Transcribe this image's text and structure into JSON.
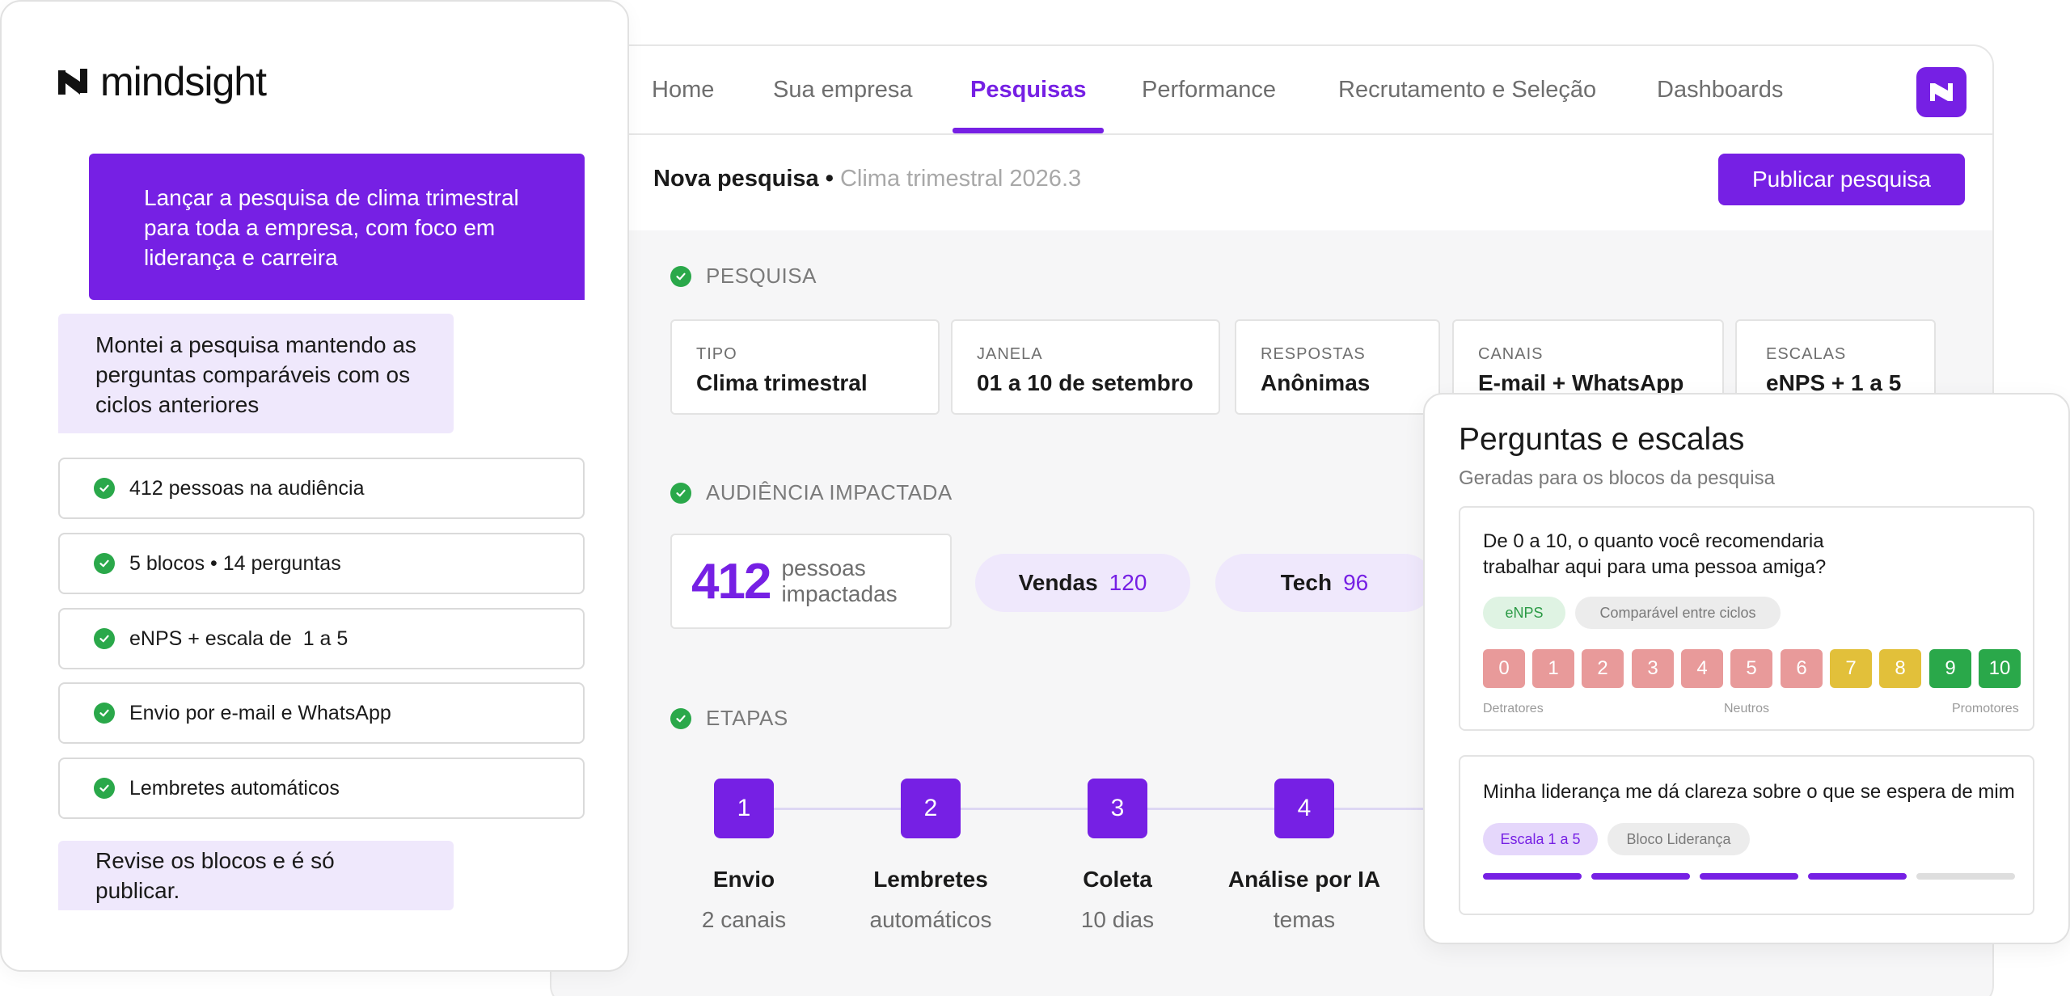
{
  "brand": {
    "name": "mindsight"
  },
  "nav": {
    "tabs": [
      {
        "label": "Home",
        "active": false
      },
      {
        "label": "Sua empresa",
        "active": false
      },
      {
        "label": "Pesquisas",
        "active": true
      },
      {
        "label": "Performance",
        "active": false
      },
      {
        "label": "Recrutamento e Seleção",
        "active": false
      },
      {
        "label": "Dashboards",
        "active": false
      }
    ]
  },
  "subheader": {
    "title": "Nova pesquisa",
    "separator": "•",
    "subtitle": "Clima trimestral 2026.3",
    "publish_button": "Publicar pesquisa"
  },
  "pesquisa": {
    "heading": "PESQUISA",
    "cards": [
      {
        "label": "TIPO",
        "value": "Clima trimestral"
      },
      {
        "label": "JANELA",
        "value": "01 a 10 de setembro"
      },
      {
        "label": "RESPOSTAS",
        "value": "Anônimas"
      },
      {
        "label": "CANAIS",
        "value": "E-mail + WhatsApp"
      },
      {
        "label": "ESCALAS",
        "value": "eNPS + 1 a 5"
      }
    ]
  },
  "audiencia": {
    "heading": "AUDIÊNCIA IMPACTADA",
    "total": "412",
    "total_label": "pessoas impactadas",
    "groups": [
      {
        "name": "Vendas",
        "count": "120"
      },
      {
        "name": "Tech",
        "count": "96"
      }
    ]
  },
  "etapas": {
    "heading": "ETAPAS",
    "steps": [
      {
        "num": "1",
        "name": "Envio",
        "detail": "2 canais"
      },
      {
        "num": "2",
        "name": "Lembretes",
        "detail": "automáticos"
      },
      {
        "num": "3",
        "name": "Coleta",
        "detail": "10 dias"
      },
      {
        "num": "4",
        "name": "Análise por IA",
        "detail": "temas"
      }
    ]
  },
  "chat": {
    "user_message": "Lançar a pesquisa de clima trimestral para toda a empresa, com foco em liderança e carreira",
    "bot_message": "Montei a pesquisa mantendo as perguntas comparáveis com os ciclos anteriores",
    "checklist": [
      "412 pessoas na audiência",
      "5 blocos • 14 perguntas",
      "eNPS + escala de  1 a 5",
      "Envio por e-mail e WhatsApp",
      "Lembretes automáticos"
    ],
    "closing": "Revise os blocos e é só publicar."
  },
  "questions": {
    "title": "Perguntas e escalas",
    "subtitle": "Geradas para os blocos da pesquisa",
    "items": [
      {
        "text": "De 0 a 10, o quanto você recomendaria\ntrabalhar aqui para uma pessoa amiga?",
        "tags": [
          "eNPS",
          "Comparável entre ciclos"
        ],
        "scale": [
          "0",
          "1",
          "2",
          "3",
          "4",
          "5",
          "6",
          "7",
          "8",
          "9",
          "10"
        ],
        "scale_labels": [
          "Detratores",
          "Neutros",
          "Promotores"
        ]
      },
      {
        "text": "Minha liderança me dá clareza sobre o que se espera de mim",
        "tags": [
          "Escala 1 a 5",
          "Bloco Liderança"
        ],
        "filled_segments": 4,
        "total_segments": 5
      }
    ]
  },
  "colors": {
    "accent": "#7620e4",
    "accent_light": "#efe8fc",
    "success": "#2aa84a",
    "detractor": "#e89a9a",
    "neutral": "#e2c03a",
    "promoter": "#2aa84a"
  }
}
